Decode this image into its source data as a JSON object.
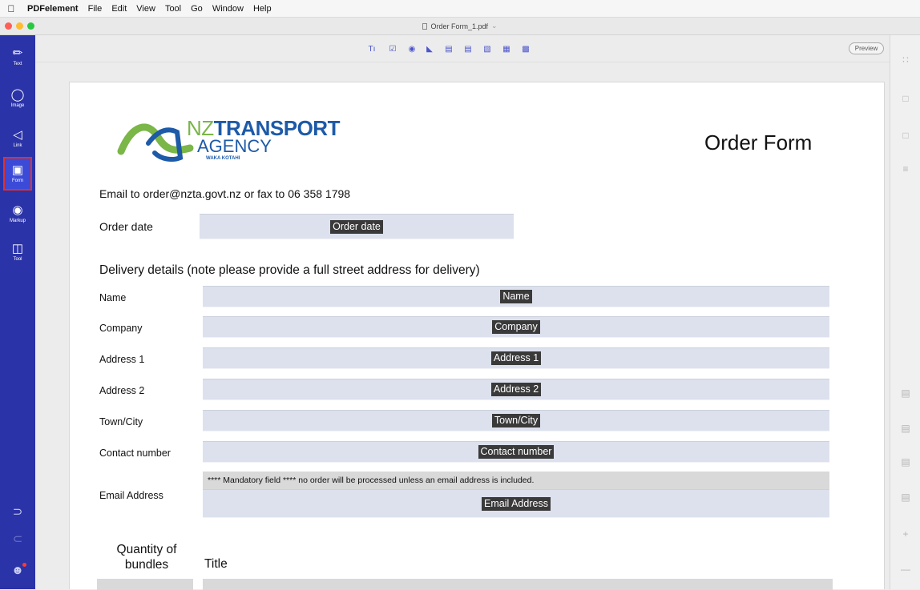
{
  "menubar": {
    "apple_icon": "apple-icon",
    "items": [
      "PDFelement",
      "File",
      "Edit",
      "View",
      "Tool",
      "Go",
      "Window",
      "Help"
    ]
  },
  "window": {
    "title": "Order Form_1.pdf",
    "traffic_light_colors": [
      "#fe5f57",
      "#febc2e",
      "#28c840"
    ]
  },
  "sidebar": {
    "color": "#2b33a8",
    "tools": [
      {
        "label": "Text",
        "icon": "pencil-icon"
      },
      {
        "label": "Image",
        "icon": "image-icon"
      },
      {
        "label": "Link",
        "icon": "link-icon"
      },
      {
        "label": "Form",
        "icon": "form-icon",
        "active": true
      },
      {
        "label": "Markup",
        "icon": "markup-icon"
      },
      {
        "label": "Tool",
        "icon": "tool-icon"
      }
    ]
  },
  "toolbar": {
    "buttons": [
      "text-field-icon",
      "checkbox-icon",
      "radio-button-icon",
      "combo-box-icon",
      "list-box-icon",
      "dropdown-icon",
      "signature-icon",
      "push-button-icon",
      "barcode-icon"
    ],
    "preview_label": "Preview"
  },
  "document": {
    "logo": {
      "nz": "NZ",
      "transport": "TRANSPORT",
      "agency": "AGENCY",
      "waka": "WAKA KOTAHI"
    },
    "form_title": "Order Form",
    "email_line": "Email to order@nzta.govt.nz or fax to 06 358 1798",
    "order_date": {
      "label": "Order date",
      "field": "Order date"
    },
    "delivery_heading": "Delivery details (note please provide a full street address for delivery)",
    "fields": [
      {
        "label": "Name",
        "field": "Name"
      },
      {
        "label": "Company",
        "field": "Company"
      },
      {
        "label": "Address 1",
        "field": "Address 1"
      },
      {
        "label": "Address 2",
        "field": "Address 2"
      },
      {
        "label": "Town/City",
        "field": "Town/City"
      },
      {
        "label": "Contact number",
        "field": "Contact number"
      }
    ],
    "email_address": {
      "label": "Email Address",
      "notice": "**** Mandatory field **** no order will be processed unless an email address is included.",
      "field": "Email Address"
    },
    "table": {
      "col1": "Quantity of bundles",
      "col2": "Title"
    }
  }
}
